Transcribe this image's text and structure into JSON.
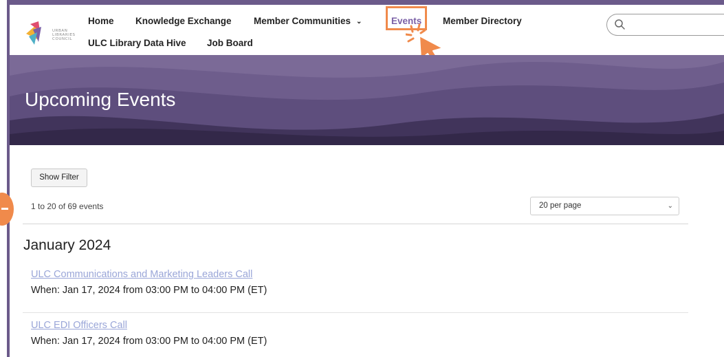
{
  "logo": {
    "lines": [
      "URBAN",
      "LIBRARIES",
      "COUNCIL"
    ]
  },
  "nav": {
    "home": "Home",
    "knowledge_exchange": "Knowledge Exchange",
    "member_communities": "Member Communities",
    "events": "Events",
    "member_directory": "Member Directory",
    "data_hive": "ULC Library Data Hive",
    "job_board": "Job Board"
  },
  "search": {
    "placeholder": ""
  },
  "hero": {
    "title": "Upcoming Events"
  },
  "controls": {
    "show_filter": "Show Filter",
    "count": "1 to 20 of 69 events",
    "per_page": "20 per page"
  },
  "month": "January 2024",
  "events": [
    {
      "title": "ULC Communications and Marketing Leaders Call",
      "when": "When:  Jan 17, 2024 from 03:00 PM to 04:00 PM (ET)"
    },
    {
      "title": "ULC EDI Officers Call",
      "when": "When:  Jan 17, 2024 from 03:00 PM to 04:00 PM (ET)"
    }
  ],
  "colors": {
    "accent": "#f08a4b",
    "brand": "#6b5a8a",
    "link": "#9aa6d8"
  }
}
